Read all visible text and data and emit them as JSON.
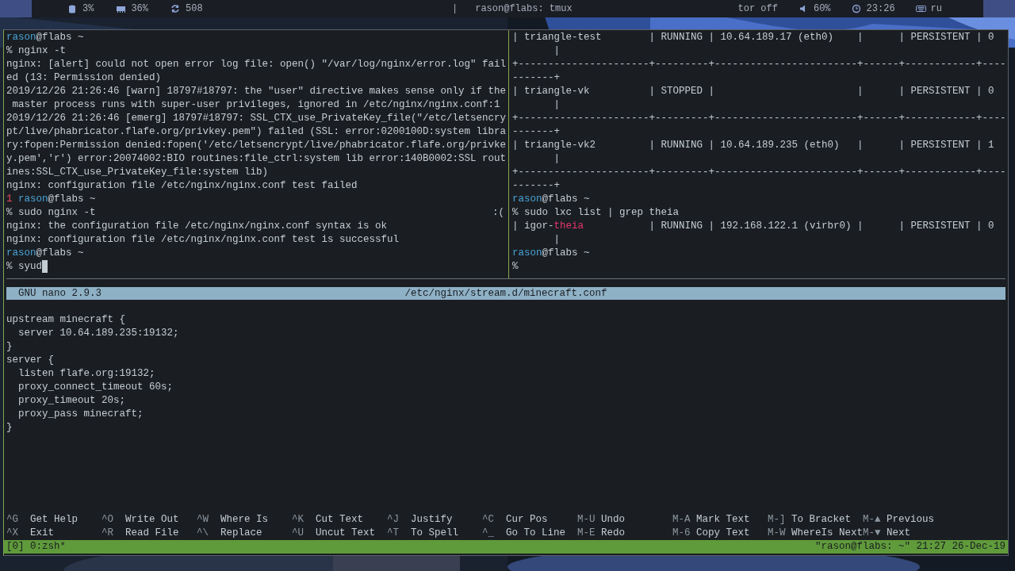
{
  "top_bar": {
    "left": [
      {
        "kind": "disk",
        "text": "3%"
      },
      {
        "kind": "memory",
        "text": "36%"
      },
      {
        "kind": "refresh",
        "text": "508"
      }
    ],
    "center": [
      {
        "text": "|"
      },
      {
        "text": "rason@flabs: tmux"
      }
    ],
    "right": [
      {
        "text": "tor off"
      },
      {
        "kind": "volume",
        "text": "60%"
      },
      {
        "kind": "clock",
        "text": "23:26"
      },
      {
        "kind": "keyboard",
        "text": "ru"
      }
    ]
  },
  "left_pane": {
    "lines": [
      {
        "segments": [
          {
            "kind": "user",
            "text": "rason"
          },
          {
            "kind": "host",
            "text": "@flabs ~"
          }
        ],
        "cursor": false
      },
      {
        "text": "% nginx -t",
        "cursor": false
      },
      {
        "text": "nginx: [alert] could not open error log file: open() \"/var/log/nginx/error.log\" fail",
        "cursor": false
      },
      {
        "text": "ed (13: Permission denied)",
        "cursor": false
      },
      {
        "text": "2019/12/26 21:26:46 [warn] 18797#18797: the \"user\" directive makes sense only if the",
        "cursor": false
      },
      {
        "text": " master process runs with super-user privileges, ignored in /etc/nginx/nginx.conf:1",
        "cursor": false
      },
      {
        "text": "2019/12/26 21:26:46 [emerg] 18797#18797: SSL_CTX_use_PrivateKey_file(\"/etc/letsencry",
        "cursor": false
      },
      {
        "text": "pt/live/phabricator.flafe.org/privkey.pem\") failed (SSL: error:0200100D:system libra",
        "cursor": false
      },
      {
        "text": "ry:fopen:Permission denied:fopen('/etc/letsencrypt/live/phabricator.flafe.org/privke",
        "cursor": false
      },
      {
        "text": "y.pem','r') error:20074002:BIO routines:file_ctrl:system lib error:140B0002:SSL rout",
        "cursor": false
      },
      {
        "text": "ines:SSL_CTX_use_PrivateKey_file:system lib)",
        "cursor": false
      },
      {
        "text": "nginx: configuration file /etc/nginx/nginx.conf test failed",
        "cursor": false
      },
      {
        "segments": [
          {
            "kind": "error",
            "text": "1 "
          },
          {
            "kind": "user",
            "text": "rason"
          },
          {
            "kind": "host",
            "text": "@flabs ~"
          }
        ],
        "cursor": false
      },
      {
        "segments": [
          {
            "kind": "text",
            "text": "% sudo nginx -t"
          },
          {
            "kind": "right",
            "text": ":("
          }
        ],
        "cursor": false
      },
      {
        "text": "nginx: the configuration file /etc/nginx/nginx.conf syntax is ok",
        "cursor": false
      },
      {
        "text": "nginx: configuration file /etc/nginx/nginx.conf test is successful",
        "cursor": false
      },
      {
        "segments": [
          {
            "kind": "user",
            "text": "rason"
          },
          {
            "kind": "host",
            "text": "@flabs ~"
          }
        ],
        "cursor": false
      },
      {
        "text": "% syud",
        "cursor": true
      }
    ]
  },
  "right_pane": {
    "lines": [
      {
        "text": "| triangle-test        | RUNNING | 10.64.189.17 (eth0)    |      | PERSISTENT | 0",
        "cursor": false
      },
      {
        "text": "       |",
        "cursor": false
      },
      {
        "text": "+----------------------+---------+------------------------+------+------------+----",
        "cursor": false
      },
      {
        "text": "-------+",
        "cursor": false
      },
      {
        "text": "| triangle-vk          | STOPPED |                        |      | PERSISTENT | 0",
        "cursor": false
      },
      {
        "text": "       |",
        "cursor": false
      },
      {
        "text": "+----------------------+---------+------------------------+------+------------+----",
        "cursor": false
      },
      {
        "text": "-------+",
        "cursor": false
      },
      {
        "text": "| triangle-vk2         | RUNNING | 10.64.189.235 (eth0)   |      | PERSISTENT | 1",
        "cursor": false
      },
      {
        "text": "       |",
        "cursor": false
      },
      {
        "text": "+----------------------+---------+------------------------+------+------------+----",
        "cursor": false
      },
      {
        "text": "-------+",
        "cursor": false
      },
      {
        "segments": [
          {
            "kind": "user",
            "text": "rason"
          },
          {
            "kind": "host",
            "text": "@flabs ~"
          }
        ],
        "cursor": false
      },
      {
        "text": "% sudo lxc list | grep theia",
        "cursor": false
      },
      {
        "segments": [
          {
            "kind": "text",
            "text": "| igor-"
          },
          {
            "kind": "match",
            "text": "theia"
          },
          {
            "kind": "text",
            "text": "           | RUNNING | 192.168.122.1 (virbr0) |      | PERSISTENT | 0"
          }
        ],
        "cursor": false
      },
      {
        "text": "       |",
        "cursor": false
      },
      {
        "segments": [
          {
            "kind": "user",
            "text": "rason"
          },
          {
            "kind": "host",
            "text": "@flabs ~"
          }
        ],
        "cursor": false
      },
      {
        "text": "%",
        "cursor": false
      }
    ]
  },
  "nano": {
    "app": "GNU nano 2.9.3",
    "file": "/etc/nginx/stream.d/minecraft.conf",
    "lines": [
      "upstream minecraft {",
      "  server 10.64.189.235:19132;",
      "}",
      "server {",
      "  listen flafe.org:19132;",
      "  proxy_connect_timeout 60s;",
      "  proxy_timeout 20s;",
      "  proxy_pass minecraft;",
      "}"
    ],
    "shortcuts": [
      [
        {
          "key": "^G",
          "label": "Get Help"
        },
        {
          "key": "^O",
          "label": "Write Out"
        },
        {
          "key": "^W",
          "label": "Where Is"
        },
        {
          "key": "^K",
          "label": "Cut Text"
        },
        {
          "key": "^J",
          "label": "Justify"
        },
        {
          "key": "^C",
          "label": "Cur Pos"
        },
        {
          "key": "M-U",
          "label": "Undo"
        },
        {
          "key": "M-A",
          "label": "Mark Text"
        },
        {
          "key": "M-]",
          "label": "To Bracket"
        },
        {
          "key": "M-▲",
          "label": "Previous"
        }
      ],
      [
        {
          "key": "^X",
          "label": "Exit"
        },
        {
          "key": "^R",
          "label": "Read File"
        },
        {
          "key": "^\\",
          "label": "Replace"
        },
        {
          "key": "^U",
          "label": "Uncut Text"
        },
        {
          "key": "^T",
          "label": "To Spell"
        },
        {
          "key": "^_",
          "label": "Go To Line"
        },
        {
          "key": "M-E",
          "label": "Redo"
        },
        {
          "key": "M-6",
          "label": "Copy Text"
        },
        {
          "key": "M-W",
          "label": "WhereIs Next"
        },
        {
          "key": "M-▼",
          "label": "Next"
        }
      ]
    ]
  },
  "status_bar": {
    "window": "[0] 0:zsh*",
    "info": "\"rason@flabs: ~\" 21:27 26-Dec-19"
  }
}
